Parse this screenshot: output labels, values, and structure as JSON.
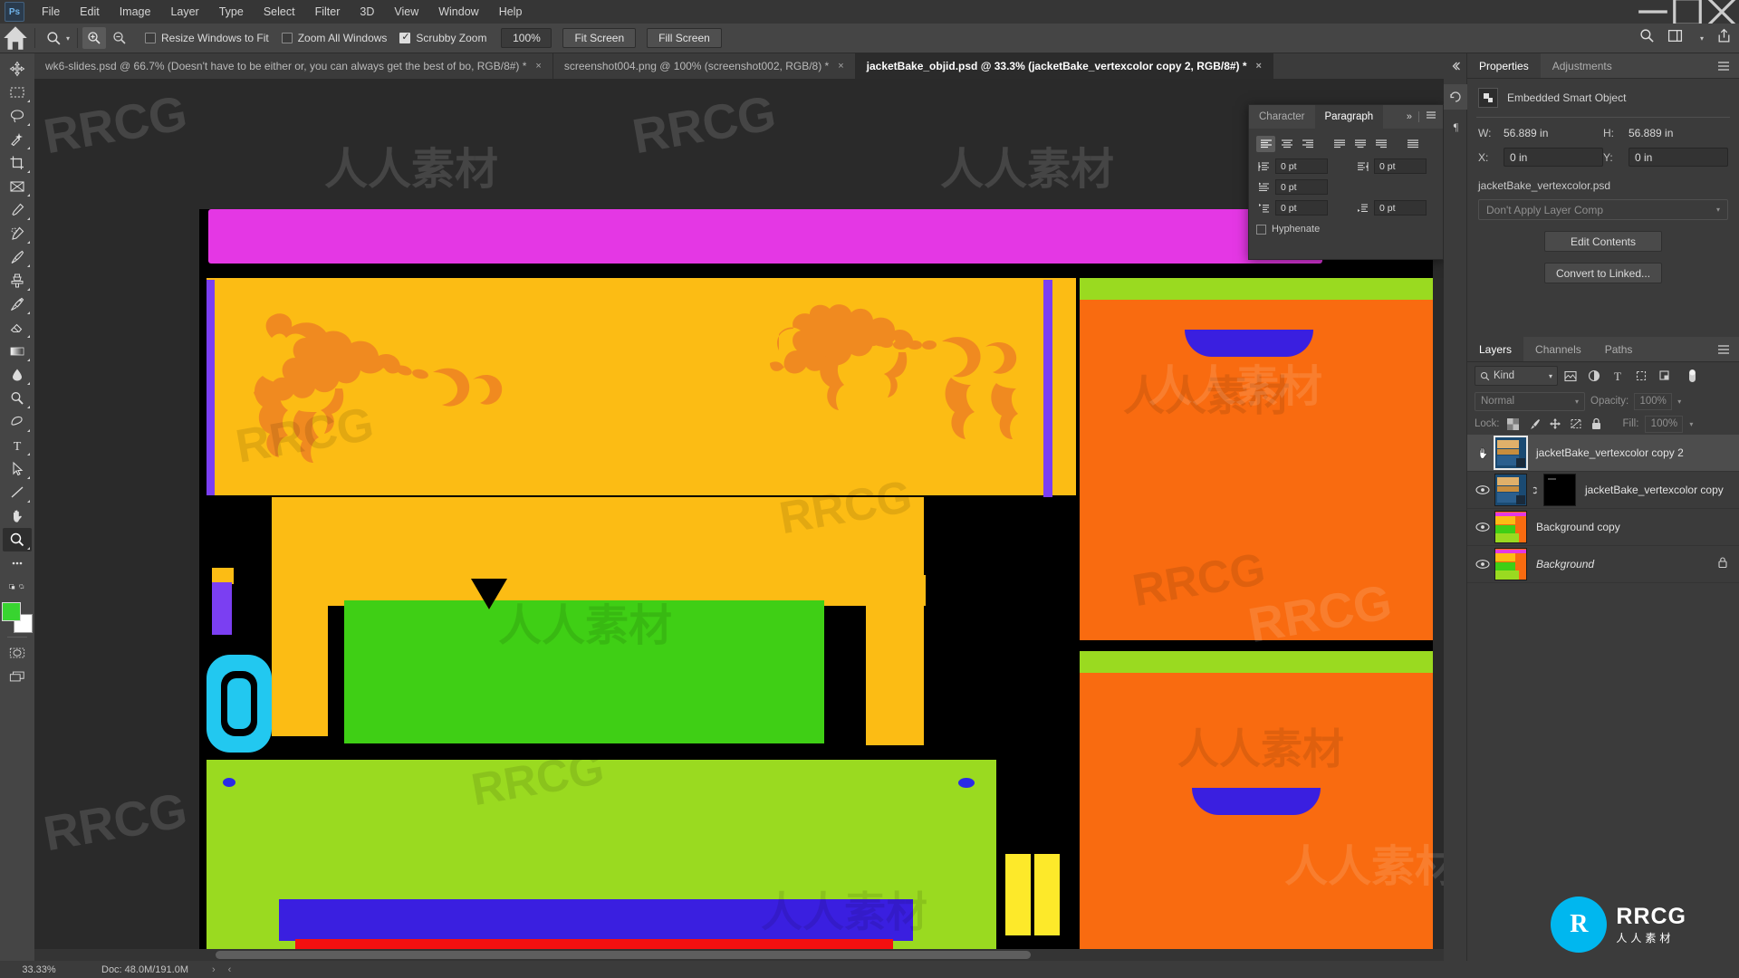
{
  "app": {
    "logo": "Ps",
    "menu": [
      "File",
      "Edit",
      "Image",
      "Layer",
      "Type",
      "Select",
      "Filter",
      "3D",
      "View",
      "Window",
      "Help"
    ],
    "window_controls": [
      "minimize",
      "maximize",
      "close"
    ]
  },
  "options_bar": {
    "home_icon": "home-icon",
    "tool_icon": "zoom-tool-icon",
    "tool_chevron": "chevron-down-icon",
    "zoom_in_icon": "zoom-in-icon",
    "zoom_out_icon": "zoom-out-icon",
    "checkboxes": [
      {
        "label": "Resize Windows to Fit",
        "checked": false
      },
      {
        "label": "Zoom All Windows",
        "checked": false
      },
      {
        "label": "Scrubby Zoom",
        "checked": true
      }
    ],
    "zoom_value": "100%",
    "buttons": [
      "Fit Screen",
      "Fill Screen"
    ],
    "right_icons": [
      "search-icon",
      "workspace-icon",
      "chevron-down-icon",
      "share-icon"
    ]
  },
  "document_tabs": [
    {
      "label": "wk6-slides.psd @ 66.7% (Doesn't have to be either or, you can always get the best of bo, RGB/8#) *",
      "active": false,
      "close": "×"
    },
    {
      "label": "screenshot004.png @ 100% (screenshot002, RGB/8) *",
      "active": false,
      "close": "×"
    },
    {
      "label": "jacketBake_objid.psd @ 33.3% (jacketBake_vertexcolor copy 2, RGB/8#) *",
      "active": true,
      "close": "×"
    }
  ],
  "toolbar": {
    "tools": [
      {
        "name": "move-tool",
        "selected": false
      },
      {
        "name": "rectangular-marquee-tool",
        "selected": false
      },
      {
        "name": "lasso-tool",
        "selected": false
      },
      {
        "name": "quick-selection-tool",
        "selected": false
      },
      {
        "name": "crop-tool",
        "selected": false
      },
      {
        "name": "frame-tool",
        "selected": false
      },
      {
        "name": "eyedropper-tool",
        "selected": false
      },
      {
        "name": "spot-healing-brush-tool",
        "selected": false
      },
      {
        "name": "brush-tool",
        "selected": false
      },
      {
        "name": "clone-stamp-tool",
        "selected": false
      },
      {
        "name": "history-brush-tool",
        "selected": false
      },
      {
        "name": "eraser-tool",
        "selected": false
      },
      {
        "name": "gradient-tool",
        "selected": false
      },
      {
        "name": "blur-tool",
        "selected": false
      },
      {
        "name": "dodge-tool",
        "selected": false
      },
      {
        "name": "pen-tool",
        "selected": false
      },
      {
        "name": "horizontal-type-tool",
        "selected": false
      },
      {
        "name": "path-selection-tool",
        "selected": false
      },
      {
        "name": "line-tool",
        "selected": false
      },
      {
        "name": "hand-tool",
        "selected": false
      },
      {
        "name": "zoom-tool",
        "selected": true
      }
    ],
    "more_tools": "ellipsis-icon",
    "edit_toolbar": "edit-toolbar-icon",
    "foreground_color": "#38d430",
    "background_color": "#ffffff",
    "quick_mask": "quick-mask-icon",
    "screen_mode": "screen-mode-icon"
  },
  "paragraph_panel": {
    "tabs": [
      {
        "label": "Character",
        "active": false
      },
      {
        "label": "Paragraph",
        "active": true
      }
    ],
    "collapse_icon": "double-chevron-icon",
    "menu_icon": "panel-menu-icon",
    "align_buttons": [
      "align-left-icon",
      "align-center-icon",
      "align-right-icon",
      "justify-last-left-icon",
      "justify-last-center-icon",
      "justify-last-right-icon",
      "justify-all-icon"
    ],
    "selected_align_index": 0,
    "indents": [
      {
        "icon": "indent-left-margin-icon",
        "value": "0 pt"
      },
      {
        "icon": "indent-right-margin-icon",
        "value": "0 pt"
      },
      {
        "icon": "indent-first-line-icon",
        "value": "0 pt"
      },
      {
        "icon": "space-before-paragraph-icon",
        "value": "0 pt"
      },
      {
        "icon": "space-after-paragraph-icon",
        "value": "0 pt"
      }
    ],
    "hyphenate": {
      "label": "Hyphenate",
      "checked": false
    }
  },
  "properties_panel": {
    "tabs": [
      {
        "label": "Properties",
        "active": true
      },
      {
        "label": "Adjustments",
        "active": false
      }
    ],
    "menu_icon": "panel-menu-icon",
    "object_type": "Embedded Smart Object",
    "object_icon": "smart-object-icon",
    "w_label": "W:",
    "w_value": "56.889 in",
    "h_label": "H:",
    "h_value": "56.889 in",
    "x_label": "X:",
    "x_value": "0 in",
    "y_label": "Y:",
    "y_value": "0 in",
    "source_file": "jacketBake_vertexcolor.psd",
    "layer_comp": "Don't Apply Layer Comp",
    "buttons": [
      "Edit Contents",
      "Convert to Linked..."
    ]
  },
  "layers_panel": {
    "tabs": [
      {
        "label": "Layers",
        "active": true
      },
      {
        "label": "Channels",
        "active": false
      },
      {
        "label": "Paths",
        "active": false
      }
    ],
    "menu_icon": "panel-menu-icon",
    "filter_label": "Kind",
    "filter_icon": "search-icon",
    "filter_chevron": "chevron-down-icon",
    "filter_type_icons": [
      "pixel-filter-icon",
      "adjustment-filter-icon",
      "type-filter-icon",
      "shape-filter-icon",
      "smart-object-filter-icon"
    ],
    "filter_toggle": "filter-toggle-icon",
    "blend_mode": "Normal",
    "opacity_label": "Opacity:",
    "opacity_value": "100%",
    "lock_label": "Lock:",
    "lock_icons": [
      "lock-transparent-pixels-icon",
      "lock-image-pixels-icon",
      "lock-position-icon",
      "lock-artboard-nesting-icon",
      "lock-all-icon"
    ],
    "fill_label": "Fill:",
    "fill_value": "100%",
    "layers": [
      {
        "name": "jacketBake_vertexcolor copy 2",
        "visible": false,
        "selected": true,
        "has_mask": false,
        "linked": false,
        "locked": false,
        "italic": false,
        "cursor": "hand-cursor-icon"
      },
      {
        "name": "jacketBake_vertexcolor copy",
        "visible": true,
        "selected": false,
        "has_mask": true,
        "linked": true,
        "locked": false,
        "italic": false
      },
      {
        "name": "Background copy",
        "visible": true,
        "selected": false,
        "has_mask": false,
        "linked": false,
        "locked": false,
        "italic": false
      },
      {
        "name": "Background",
        "visible": true,
        "selected": false,
        "has_mask": false,
        "linked": false,
        "locked": true,
        "italic": true
      }
    ]
  },
  "icon_strip": [
    "collapse-panels-icon",
    "history-icon",
    "paragraph-marks-icon"
  ],
  "status_bar": {
    "zoom": "33.33%",
    "doc_info": "Doc: 48.0M/191.0M",
    "arrow_right": "›",
    "arrow_left": "‹"
  },
  "watermarks": {
    "latin": "RRCG",
    "cjk": "人人素材"
  },
  "branding": {
    "circle_glyph": "R",
    "name": "RRCG",
    "subtitle": "人人素材"
  },
  "canvas": {
    "zoom_level": "33.33%",
    "artwork_description": "UV texture atlas of a jacket with dragon motifs",
    "colors": {
      "black": "#000000",
      "magenta": "#e437e4",
      "gold": "#fcbc14",
      "orange_dragon": "#f08a20",
      "purple": "#7b3ff2",
      "green": "#3fcf15",
      "lime": "#9ada20",
      "cyan": "#22c8f0",
      "orange": "#f96b10",
      "blue": "#3a1fe0",
      "red": "#f41010",
      "yellow": "#fde92a"
    }
  }
}
